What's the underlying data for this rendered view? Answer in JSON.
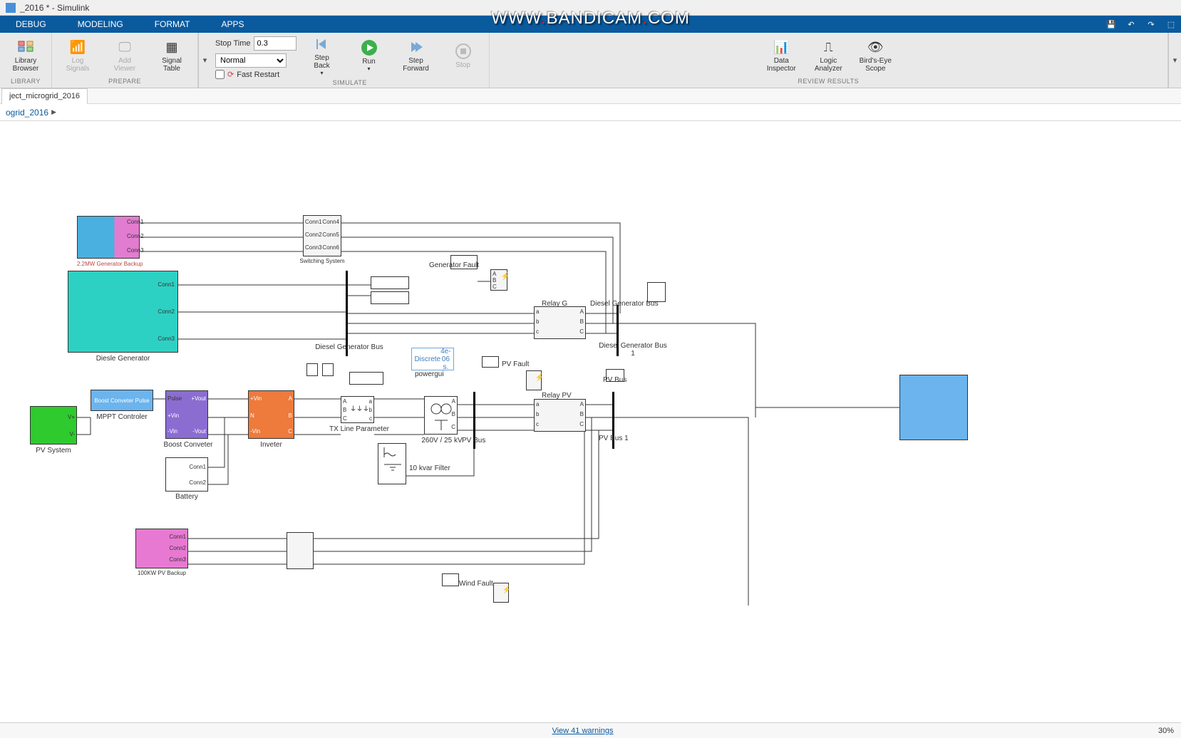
{
  "title": "_2016 * - Simulink",
  "watermark_base": "WWW",
  "watermark_domain": "BANDICAM",
  "watermark_tld": "COM",
  "menu": {
    "debug": "DEBUG",
    "modeling": "MODELING",
    "format": "FORMAT",
    "apps": "APPS"
  },
  "library_section": {
    "label": "LIBRARY",
    "library_browser": "Library\nBrowser"
  },
  "prepare_section": {
    "label": "PREPARE",
    "log_signals": "Log\nSignals",
    "add_viewer": "Add\nViewer",
    "signal_table": "Signal\nTable"
  },
  "simulate_section": {
    "label": "SIMULATE",
    "stop_time_label": "Stop Time",
    "stop_time_value": "0.3",
    "mode": "Normal",
    "fast_restart": "Fast Restart",
    "step_back": "Step\nBack",
    "run": "Run",
    "step_fwd": "Step\nForward",
    "stop": "Stop"
  },
  "review_section": {
    "label": "REVIEW RESULTS",
    "data_inspector": "Data\nInspector",
    "logic_analyzer": "Logic\nAnalyzer",
    "birdseye": "Bird's-Eye\nScope"
  },
  "tab": "ject_microgrid_2016",
  "breadcrumb": "ogrid_2016",
  "blocks": {
    "backup_gen": "2.2MW Generator Backup",
    "switching": "Switching System",
    "diesel": "Diesle Generator",
    "diesel_bus": "Diesel Generator Bus",
    "gen_fault": "Generator Fault",
    "relay_g": "Relay G",
    "diesel_bus1": "Diesel Generator Bus\n1",
    "powergui_l1": "Discrete",
    "powergui_l2": "4e-06 s.",
    "powergui_name": "powergui",
    "pv_system": "PV System",
    "mppt": "MPPT Controler",
    "mppt_inner": "Boost Conveter Pulse",
    "boost": "Boost Conveter",
    "inverter": "Inveter",
    "txline": "TX Line Parameter",
    "transformer": "260V / 25 kV",
    "pv_bus": "PV Bus",
    "pv_fault": "PV Fault",
    "relay_pv": "Relay PV",
    "pv_bus1": "PV Bus 1",
    "filter": "10 kvar Filter",
    "battery": "Battery",
    "pv_backup": "100KW PV Backup",
    "wind_fault": "Wind Fault"
  },
  "ports": {
    "conn1": "Conn1",
    "conn2": "Conn2",
    "conn3": "Conn3",
    "conn4": "Conn4",
    "conn5": "Conn5",
    "conn6": "Conn6",
    "a": "a",
    "b": "b",
    "c": "c",
    "A": "A",
    "B": "B",
    "C": "C",
    "vp": "V+",
    "vm": "V-",
    "pulse": "Pulse",
    "pvin": "+Vin",
    "nvin": "-Vin",
    "pvout": "+Vout",
    "nvout": "-Vout"
  },
  "status": {
    "warnings": "View 41 warnings",
    "zoom": "30%"
  }
}
